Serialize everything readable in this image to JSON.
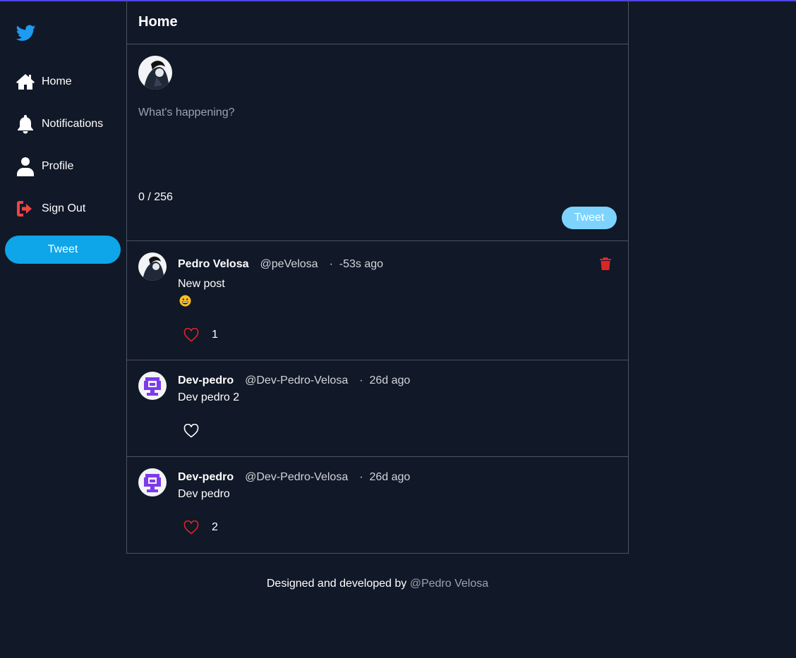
{
  "sidebar": {
    "logo_icon": "twitter-bird-icon",
    "items": [
      {
        "label": "Home",
        "icon": "home-icon"
      },
      {
        "label": "Notifications",
        "icon": "bell-icon"
      },
      {
        "label": "Profile",
        "icon": "user-icon"
      },
      {
        "label": "Sign Out",
        "icon": "sign-out-icon"
      }
    ],
    "tweet_label": "Tweet"
  },
  "header": {
    "title": "Home"
  },
  "composer": {
    "placeholder": "What's happening?",
    "counter": "0 / 256",
    "tweet_label": "Tweet"
  },
  "posts": [
    {
      "name": "Pedro Velosa",
      "handle": "@peVelosa",
      "time": "-53s ago",
      "text": "New post",
      "emoji": "😀",
      "likes": "1",
      "liked": true,
      "deletable": true
    },
    {
      "name": "Dev-pedro",
      "handle": "@Dev-Pedro-Velosa",
      "time": "26d ago",
      "text": "Dev pedro 2",
      "likes": "",
      "liked": false,
      "deletable": false
    },
    {
      "name": "Dev-pedro",
      "handle": "@Dev-Pedro-Velosa",
      "time": "26d ago",
      "text": "Dev pedro",
      "likes": "2",
      "liked": true,
      "deletable": false
    }
  ],
  "footer": {
    "text": "Designed and developed by",
    "author": "@Pedro Velosa"
  },
  "colors": {
    "background": "#111827",
    "accent": "#0ea5e9",
    "accent_light": "#7dd3fc",
    "like": "#dc2626",
    "signout": "#ef4444"
  }
}
